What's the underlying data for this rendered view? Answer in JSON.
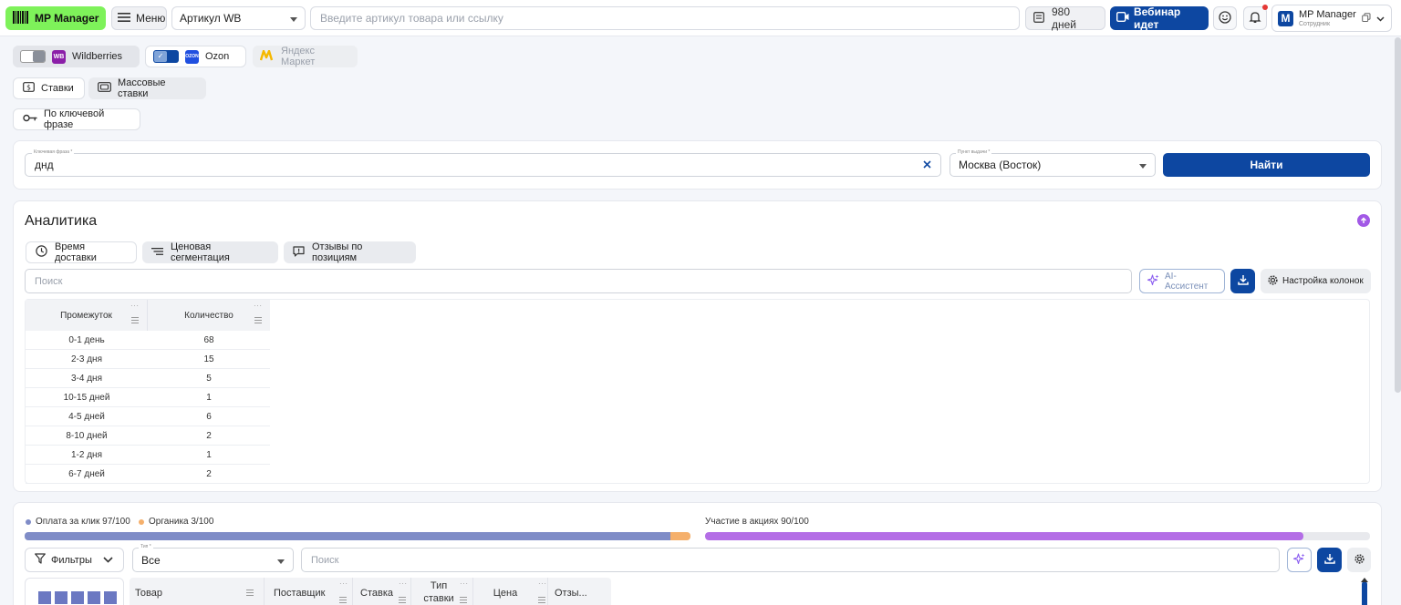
{
  "header": {
    "brand": "MP Manager",
    "menu_label": "Меню",
    "article_select": "Артикул WB",
    "search_placeholder": "Введите артикул товара или ссылку",
    "days": "980 дней",
    "webinar": "Вебинар идет",
    "profile_name": "MP Manager",
    "profile_role": "Сотрудник",
    "avatar_letter": "M"
  },
  "marketplaces": [
    {
      "label": "Wildberries",
      "badge": "WB",
      "badge_color": "#8b1fa8"
    },
    {
      "label": "Ozon",
      "badge": "OZON",
      "badge_color": "#1f4fe0"
    },
    {
      "label": "Яндекс Маркет",
      "badge": "",
      "badge_color": "#f5c400"
    }
  ],
  "tabs": {
    "bids": "Ставки",
    "mass_bids": "Массовые ставки",
    "by_keyword": "По ключевой фразе"
  },
  "search_form": {
    "keyword_label": "Ключевая фраза *",
    "keyword_value": "днд",
    "point_label": "Пункт выдачи *",
    "point_value": "Москва (Восток)",
    "find": "Найти"
  },
  "analytics": {
    "title": "Аналитика",
    "chips": [
      "Время доставки",
      "Ценовая сегментация",
      "Отзывы по позициям"
    ],
    "search_placeholder": "Поиск",
    "ai_assistant": "AI-Ассистент",
    "columns_settings": "Настройка колонок",
    "table": {
      "headers": [
        "Промежуток",
        "Количество"
      ],
      "rows": [
        [
          "0-1 день",
          "68"
        ],
        [
          "2-3 дня",
          "15"
        ],
        [
          "3-4 дня",
          "5"
        ],
        [
          "10-15 дней",
          "1"
        ],
        [
          "4-5 дней",
          "6"
        ],
        [
          "8-10 дней",
          "2"
        ],
        [
          "1-2 дня",
          "1"
        ],
        [
          "6-7 дней",
          "2"
        ]
      ]
    }
  },
  "bottom": {
    "legend_paid": "Оплата за клик 97/100",
    "legend_organic": "Органика 3/100",
    "legend_promo": "Участие в акциях 90/100",
    "paid_fraction": 0.97,
    "organic_fraction": 0.03,
    "promo_fraction": 0.9,
    "colors": {
      "paid": "#7f8cc7",
      "organic": "#f5b06c",
      "promo": "#b46ee6"
    },
    "filters": "Фильтры",
    "type_label": "Тип *",
    "type_value": "Все",
    "search_placeholder": "Поиск",
    "columns": [
      "Товар",
      "Поставщик",
      "Ставка",
      "Тип ставки",
      "Цена",
      "Отзы..."
    ]
  }
}
